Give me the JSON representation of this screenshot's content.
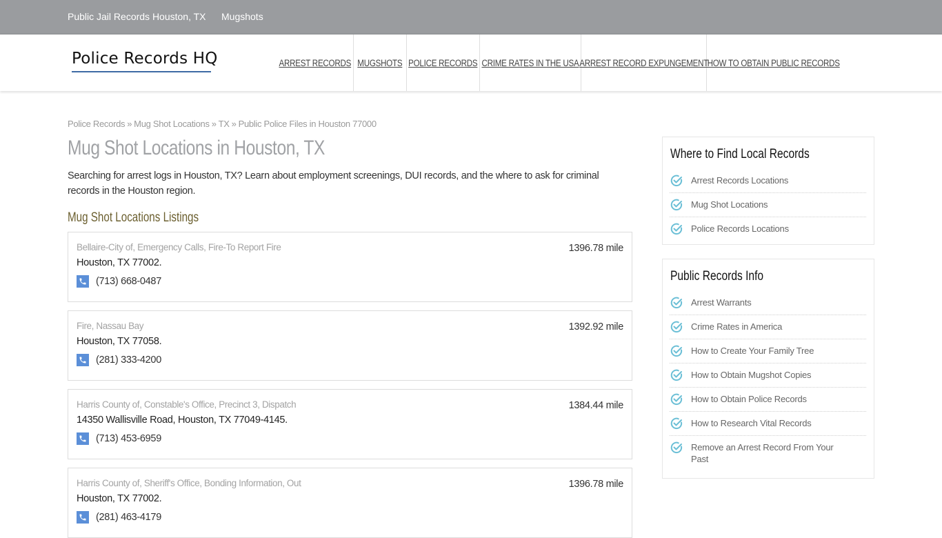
{
  "topbar": {
    "links": [
      "Public Jail Records Houston, TX",
      "Mugshots"
    ]
  },
  "header": {
    "logo": "Police Records HQ",
    "nav": [
      "Arrest Records",
      "Mugshots",
      "Police Records",
      "Crime Rates in the USA",
      "Arrest Record Expungement",
      "How to Obtain Public Records"
    ]
  },
  "breadcrumb": {
    "items": [
      "Police Records",
      "Mug Shot Locations",
      "TX",
      "Public Police Files in Houston 77000"
    ],
    "separator": "»"
  },
  "main": {
    "title": "Mug Shot Locations in Houston, TX",
    "intro": "Searching for arrest logs in Houston, TX? Learn about employment screenings, DUI records, and the where to ask for criminal records in the Houston region.",
    "section_title": "Mug Shot Locations Listings",
    "listings": [
      {
        "name": "Bellaire-City of, Emergency Calls, Fire-To Report Fire",
        "address": "Houston, TX 77002.",
        "phone": "(713) 668-0487",
        "distance": "1396.78 mile"
      },
      {
        "name": "Fire, Nassau Bay",
        "address": "Houston, TX 77058.",
        "phone": "(281) 333-4200",
        "distance": "1392.92 mile"
      },
      {
        "name": "Harris County of, Constable's Office, Precinct 3, Dispatch",
        "address": "14350 Wallisville Road, Houston, TX 77049-4145.",
        "phone": "(713) 453-6959",
        "distance": "1384.44 mile"
      },
      {
        "name": "Harris County of, Sheriff's Office, Bonding Information, Out",
        "address": "Houston, TX 77002.",
        "phone": "(281) 463-4179",
        "distance": "1396.78 mile"
      }
    ]
  },
  "sidebar": {
    "widgets": [
      {
        "title": "Where to Find Local Records",
        "items": [
          "Arrest Records Locations",
          "Mug Shot Locations",
          "Police Records Locations"
        ]
      },
      {
        "title": "Public Records Info",
        "items": [
          "Arrest Warrants",
          "Crime Rates in America",
          "How to Create Your Family Tree",
          "How to Obtain Mugshot Copies",
          "How to Obtain Police Records",
          "How to Research Vital Records",
          "Remove an Arrest Record From Your Past"
        ]
      }
    ]
  },
  "colors": {
    "topbar_bg": "#9a9c9f",
    "logo_underline": "#3e6aa4",
    "phone_icon_bg": "#5b8fd8",
    "check_icon": "#6bbfd6",
    "section_title": "#6b5f2f"
  }
}
